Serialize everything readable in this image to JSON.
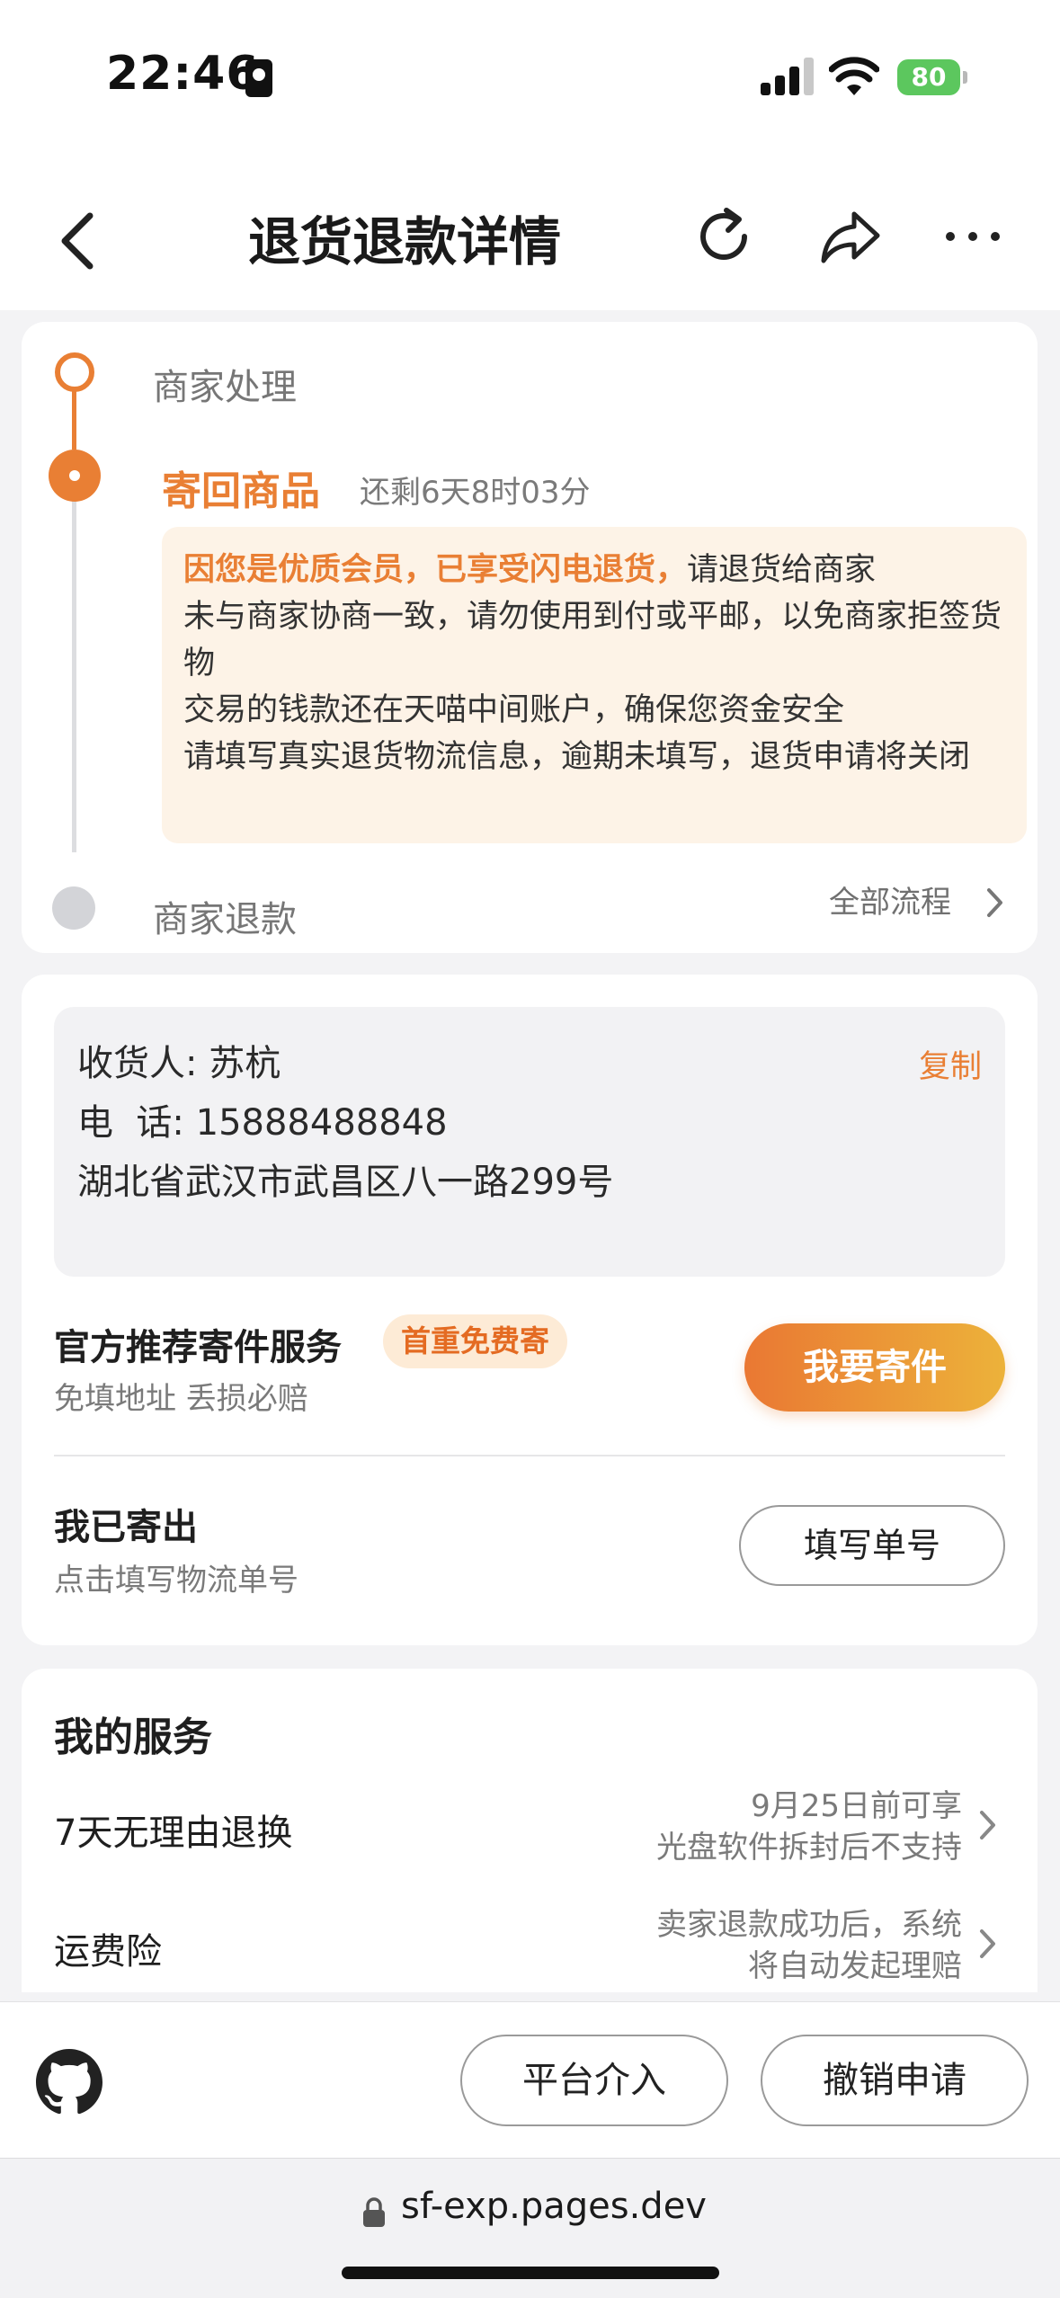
{
  "status_bar": {
    "time": "22:46",
    "battery": "80"
  },
  "nav": {
    "title": "退货退款详情",
    "icons": [
      "back-icon",
      "refresh-icon",
      "share-icon",
      "more-icon"
    ]
  },
  "timeline": {
    "step1": "商家处理",
    "step2": "寄回商品",
    "remaining": "还剩6天8时03分",
    "notice_highlight": "因您是优质会员，已享受闪电退货，",
    "notice_line1_rest": "请退货给商家",
    "notice_line2": "未与商家协商一致，请勿使用到付或平邮，以免商家拒签货物",
    "notice_line3": "交易的钱款还在天喵中间账户，确保您资金安全",
    "notice_line4": "请填写真实退货物流信息，逾期未填写，退货申请将关闭",
    "step3": "商家退款",
    "all_flow": "全部流程"
  },
  "address": {
    "receiver_label": "收货人:",
    "receiver_name": "苏杭",
    "phone_label": "电  话:",
    "phone": "15888488848",
    "address": "湖北省武汉市武昌区八一路299号",
    "copy": "复制"
  },
  "shipping": {
    "service_title": "官方推荐寄件服务",
    "service_badge": "首重免费寄",
    "service_sub": "免填地址 丢损必赔",
    "send_button": "我要寄件",
    "sent_title": "我已寄出",
    "sent_sub": "点击填写物流单号",
    "fill_button": "填写单号"
  },
  "services": {
    "title": "我的服务",
    "items": [
      {
        "name": "7天无理由退换",
        "desc_line1": "9月25日前可享",
        "desc_line2": "光盘软件拆封后不支持"
      },
      {
        "name": "运费险",
        "desc_line1": "卖家退款成功后，系统",
        "desc_line2": "将自动发起理赔"
      }
    ]
  },
  "bottom_bar": {
    "platform_button": "平台介入",
    "cancel_button": "撤销申请"
  },
  "browser": {
    "url": "sf-exp.pages.dev"
  },
  "colors": {
    "accent": "#e97f34",
    "notice_bg": "#fdf3e7",
    "badge_bg": "#fdebd6",
    "battery_green": "#5cc75e"
  }
}
